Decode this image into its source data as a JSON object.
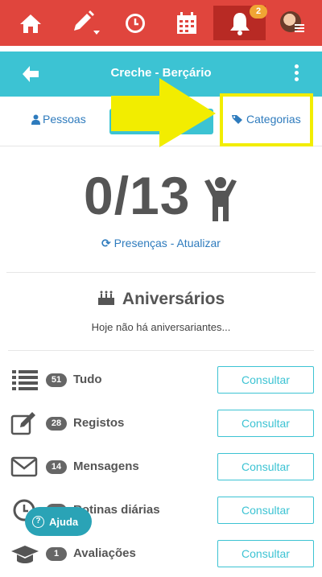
{
  "topbar": {
    "items": [
      "home-icon",
      "edit-icon",
      "clock-icon",
      "calendar-icon",
      "bell-icon"
    ],
    "notification_count": "2",
    "colors": {
      "bar": "#e0453d",
      "active": "#b82a24",
      "badge": "#f0a534"
    }
  },
  "header": {
    "title": "Creche - Berçário",
    "color": "#3cc3d3"
  },
  "tabs": {
    "pessoas": "Pessoas",
    "categorias": "Categorias"
  },
  "attendance": {
    "count": "0/13",
    "refresh": "Presenças - Atualizar"
  },
  "anniversaries": {
    "title": "Aniversários",
    "subtitle": "Hoje não há aniversariantes..."
  },
  "rows": [
    {
      "icon": "list-icon",
      "count": "51",
      "label": "Tudo",
      "button": "Consultar"
    },
    {
      "icon": "edit-note-icon",
      "count": "28",
      "label": "Registos",
      "button": "Consultar"
    },
    {
      "icon": "envelope-icon",
      "count": "14",
      "label": "Mensagens",
      "button": "Consultar"
    },
    {
      "icon": "clock-icon",
      "count": "",
      "label": "Rotinas diárias",
      "button": "Consultar"
    },
    {
      "icon": "graduation-cap-icon",
      "count": "1",
      "label": "Avaliações",
      "button": "Consultar"
    }
  ],
  "help": {
    "label": "Ajuda"
  }
}
